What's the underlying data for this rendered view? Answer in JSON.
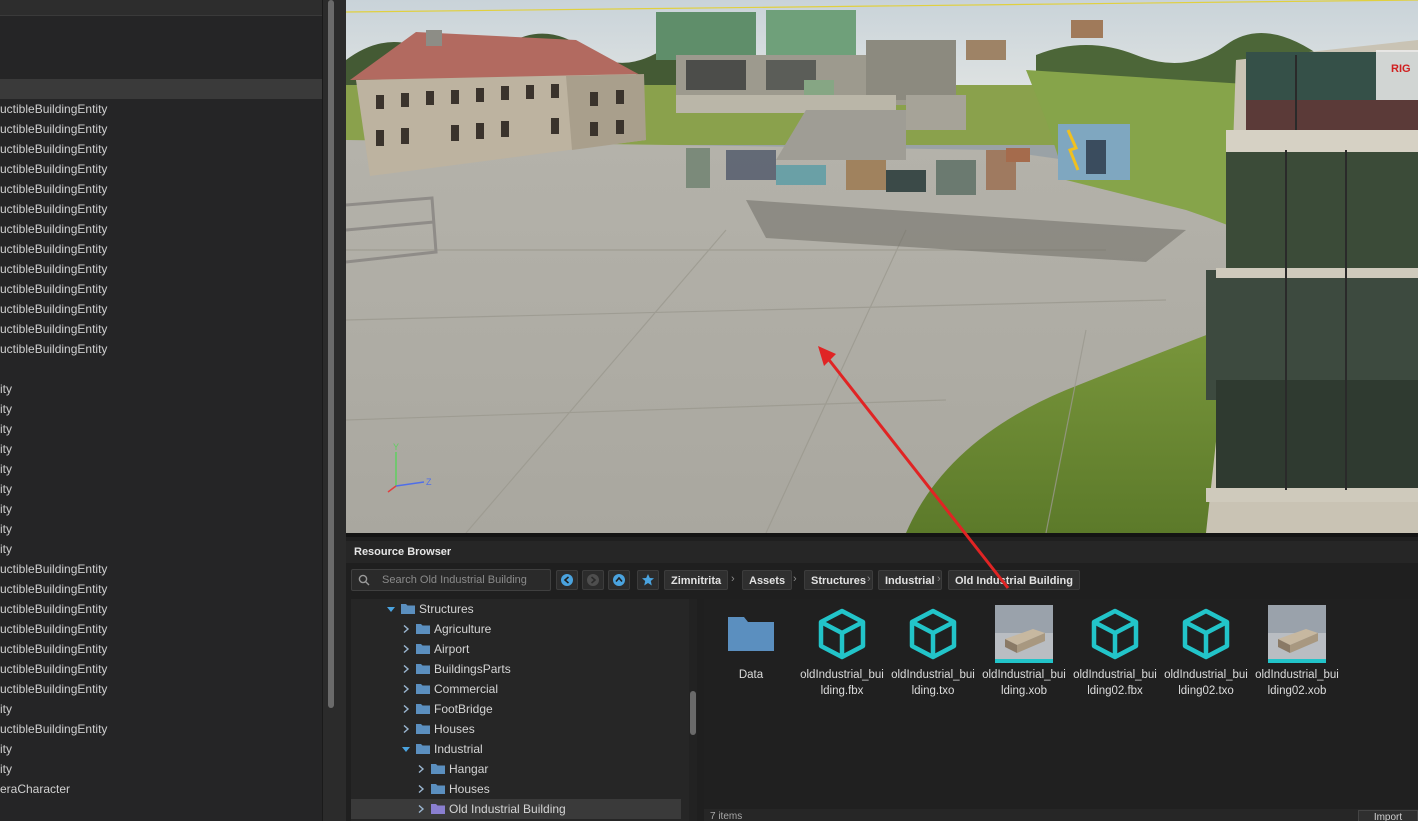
{
  "hierarchy": {
    "rows": [
      {
        "label": "uctibleBuildingEntity",
        "selected": false
      },
      {
        "label": "uctibleBuildingEntity",
        "selected": false
      },
      {
        "label": "uctibleBuildingEntity",
        "selected": false
      },
      {
        "label": "uctibleBuildingEntity",
        "selected": false
      },
      {
        "label": "uctibleBuildingEntity",
        "selected": false
      },
      {
        "label": "uctibleBuildingEntity",
        "selected": false
      },
      {
        "label": "uctibleBuildingEntity",
        "selected": false
      },
      {
        "label": "uctibleBuildingEntity",
        "selected": false
      },
      {
        "label": "uctibleBuildingEntity",
        "selected": false
      },
      {
        "label": "uctibleBuildingEntity",
        "selected": false
      },
      {
        "label": "uctibleBuildingEntity",
        "selected": false
      },
      {
        "label": "uctibleBuildingEntity",
        "selected": false
      },
      {
        "label": "uctibleBuildingEntity",
        "selected": false
      },
      {
        "label": "",
        "selected": false
      },
      {
        "label": "ity",
        "selected": false
      },
      {
        "label": "ity",
        "selected": false
      },
      {
        "label": "ity",
        "selected": false
      },
      {
        "label": "ity",
        "selected": false
      },
      {
        "label": "ity",
        "selected": false
      },
      {
        "label": "ity",
        "selected": false
      },
      {
        "label": "ity",
        "selected": false
      },
      {
        "label": "ity",
        "selected": false
      },
      {
        "label": "ity",
        "selected": false
      },
      {
        "label": "uctibleBuildingEntity",
        "selected": false
      },
      {
        "label": "uctibleBuildingEntity",
        "selected": false
      },
      {
        "label": "uctibleBuildingEntity",
        "selected": false
      },
      {
        "label": "uctibleBuildingEntity",
        "selected": false
      },
      {
        "label": "uctibleBuildingEntity",
        "selected": false
      },
      {
        "label": "uctibleBuildingEntity",
        "selected": false
      },
      {
        "label": "uctibleBuildingEntity",
        "selected": false
      },
      {
        "label": "ity",
        "selected": false
      },
      {
        "label": "uctibleBuildingEntity",
        "selected": false
      },
      {
        "label": "ity",
        "selected": false
      },
      {
        "label": "ity",
        "selected": false
      },
      {
        "label": "eraCharacter",
        "selected": false
      }
    ]
  },
  "viewport": {
    "gizmo": {
      "y_label": "Y",
      "z_label": "Z"
    },
    "sign_text": "RIG"
  },
  "resource_browser": {
    "title": "Resource Browser",
    "search_placeholder": "Search Old Industrial Building",
    "breadcrumbs": [
      "Zimnitrita",
      "Assets",
      "Structures",
      "Industrial",
      "Old Industrial Building"
    ],
    "tree": [
      {
        "label": "Structures",
        "depth": 0,
        "expanded": true,
        "selected": false
      },
      {
        "label": "Agriculture",
        "depth": 1,
        "expanded": false,
        "selected": false
      },
      {
        "label": "Airport",
        "depth": 1,
        "expanded": false,
        "selected": false
      },
      {
        "label": "BuildingsParts",
        "depth": 1,
        "expanded": false,
        "selected": false
      },
      {
        "label": "Commercial",
        "depth": 1,
        "expanded": false,
        "selected": false
      },
      {
        "label": "FootBridge",
        "depth": 1,
        "expanded": false,
        "selected": false
      },
      {
        "label": "Houses",
        "depth": 1,
        "expanded": false,
        "selected": false
      },
      {
        "label": "Industrial",
        "depth": 1,
        "expanded": true,
        "selected": false
      },
      {
        "label": "Hangar",
        "depth": 2,
        "expanded": false,
        "selected": false
      },
      {
        "label": "Houses",
        "depth": 2,
        "expanded": false,
        "selected": false
      },
      {
        "label": "Old Industrial Building",
        "depth": 2,
        "expanded": false,
        "selected": true
      }
    ],
    "files": [
      {
        "label": "Data",
        "kind": "folder-icon"
      },
      {
        "label": "oldIndustrial_building.fbx",
        "kind": "mesh-icon"
      },
      {
        "label": "oldIndustrial_building.txo",
        "kind": "mesh-icon"
      },
      {
        "label": "oldIndustrial_building.xob",
        "kind": "preview-thumbnail"
      },
      {
        "label": "oldIndustrial_building02.fbx",
        "kind": "mesh-icon"
      },
      {
        "label": "oldIndustrial_building02.txo",
        "kind": "mesh-icon"
      },
      {
        "label": "oldIndustrial_building02.xob",
        "kind": "preview-thumbnail"
      }
    ],
    "status": "7 items",
    "import_label": "Import"
  },
  "colors": {
    "accent": "#4aa3df",
    "mesh_icon": "#22c4c9",
    "folder": "#5b8fbf",
    "arrow": "#e02424"
  }
}
